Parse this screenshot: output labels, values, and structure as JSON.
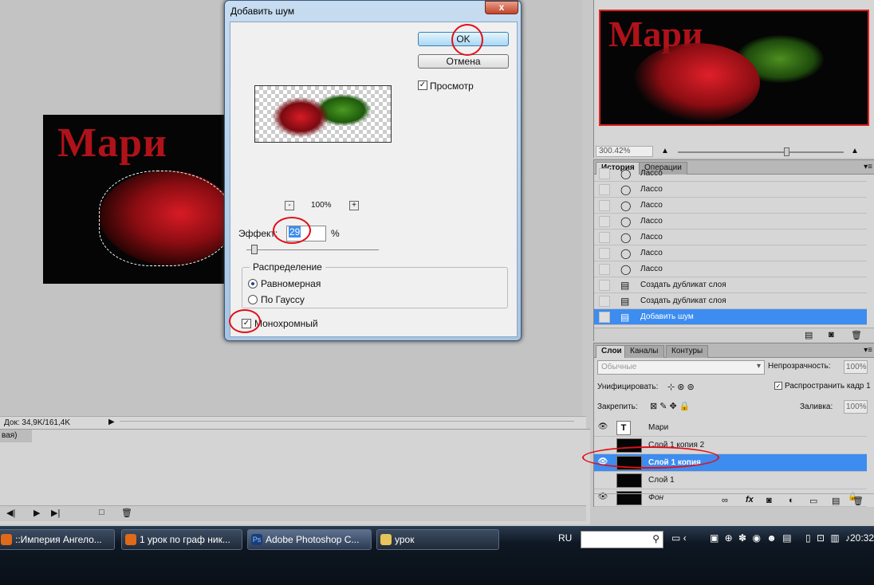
{
  "dialog": {
    "title": "Добавить шум",
    "close": "x",
    "ok": "OK",
    "cancel": "Отмена",
    "preview_label": "Просмотр",
    "preview_checked": true,
    "zoom_minus": "-",
    "zoom_plus": "+",
    "zoom": "100%",
    "amount_label": "Эффект:",
    "amount_value": "29",
    "amount_unit": "%",
    "distribution_title": "Распределение",
    "uniform": "Равномерная",
    "gaussian": "По Гауссу",
    "selected_distribution": "uniform",
    "mono": "Монохромный",
    "mono_checked": true
  },
  "canvas": {
    "doc_title_text": "Мари"
  },
  "statusbar": {
    "doc": "Док: 34,9K/161,4K",
    "play": "▶"
  },
  "animation": {
    "tab_fragment": "вая)"
  },
  "navigator": {
    "title_text": "Мари",
    "zoom": "300.42%",
    "mountain_small": "▲",
    "mountain_big": "▲"
  },
  "history": {
    "tab_history": "История",
    "tab_actions": "Операции",
    "items": [
      {
        "label": "Лассо"
      },
      {
        "label": "Лассо"
      },
      {
        "label": "Лассо"
      },
      {
        "label": "Лассо"
      },
      {
        "label": "Лассо"
      },
      {
        "label": "Лассо"
      },
      {
        "label": "Лассо"
      },
      {
        "label": "Создать дубликат слоя"
      },
      {
        "label": "Создать дубликат слоя"
      },
      {
        "label": "Добавить шум"
      }
    ]
  },
  "layers": {
    "tab_layers": "Слои",
    "tab_channels": "Каналы",
    "tab_paths": "Контуры",
    "blend_mode": "Обычные",
    "opacity_label": "Непрозрачность:",
    "opacity": "100%",
    "unify_label": "Унифицировать:",
    "spread_label": "Распространить кадр 1",
    "lock_label": "Закрепить:",
    "fill_label": "Заливка:",
    "fill": "100%",
    "items": [
      {
        "name": "Мари",
        "thumb": "T"
      },
      {
        "name": "Слой 1 копия 2",
        "thumb": ""
      },
      {
        "name": "Слой 1 копия",
        "thumb": ""
      },
      {
        "name": "Слой 1",
        "thumb": ""
      },
      {
        "name": "Фон",
        "thumb": ""
      }
    ]
  },
  "taskbar": {
    "buttons": [
      {
        "label": "::Империя Ангело..."
      },
      {
        "label": "1 урок по граф ник..."
      },
      {
        "label": "Adobe Photoshop C..."
      },
      {
        "label": "урок"
      }
    ],
    "lang": "RU",
    "time": "20:32"
  },
  "colors": {
    "accent": "#3d8cf0",
    "annotation": "#e0101a",
    "title_red": "#b0121a"
  }
}
